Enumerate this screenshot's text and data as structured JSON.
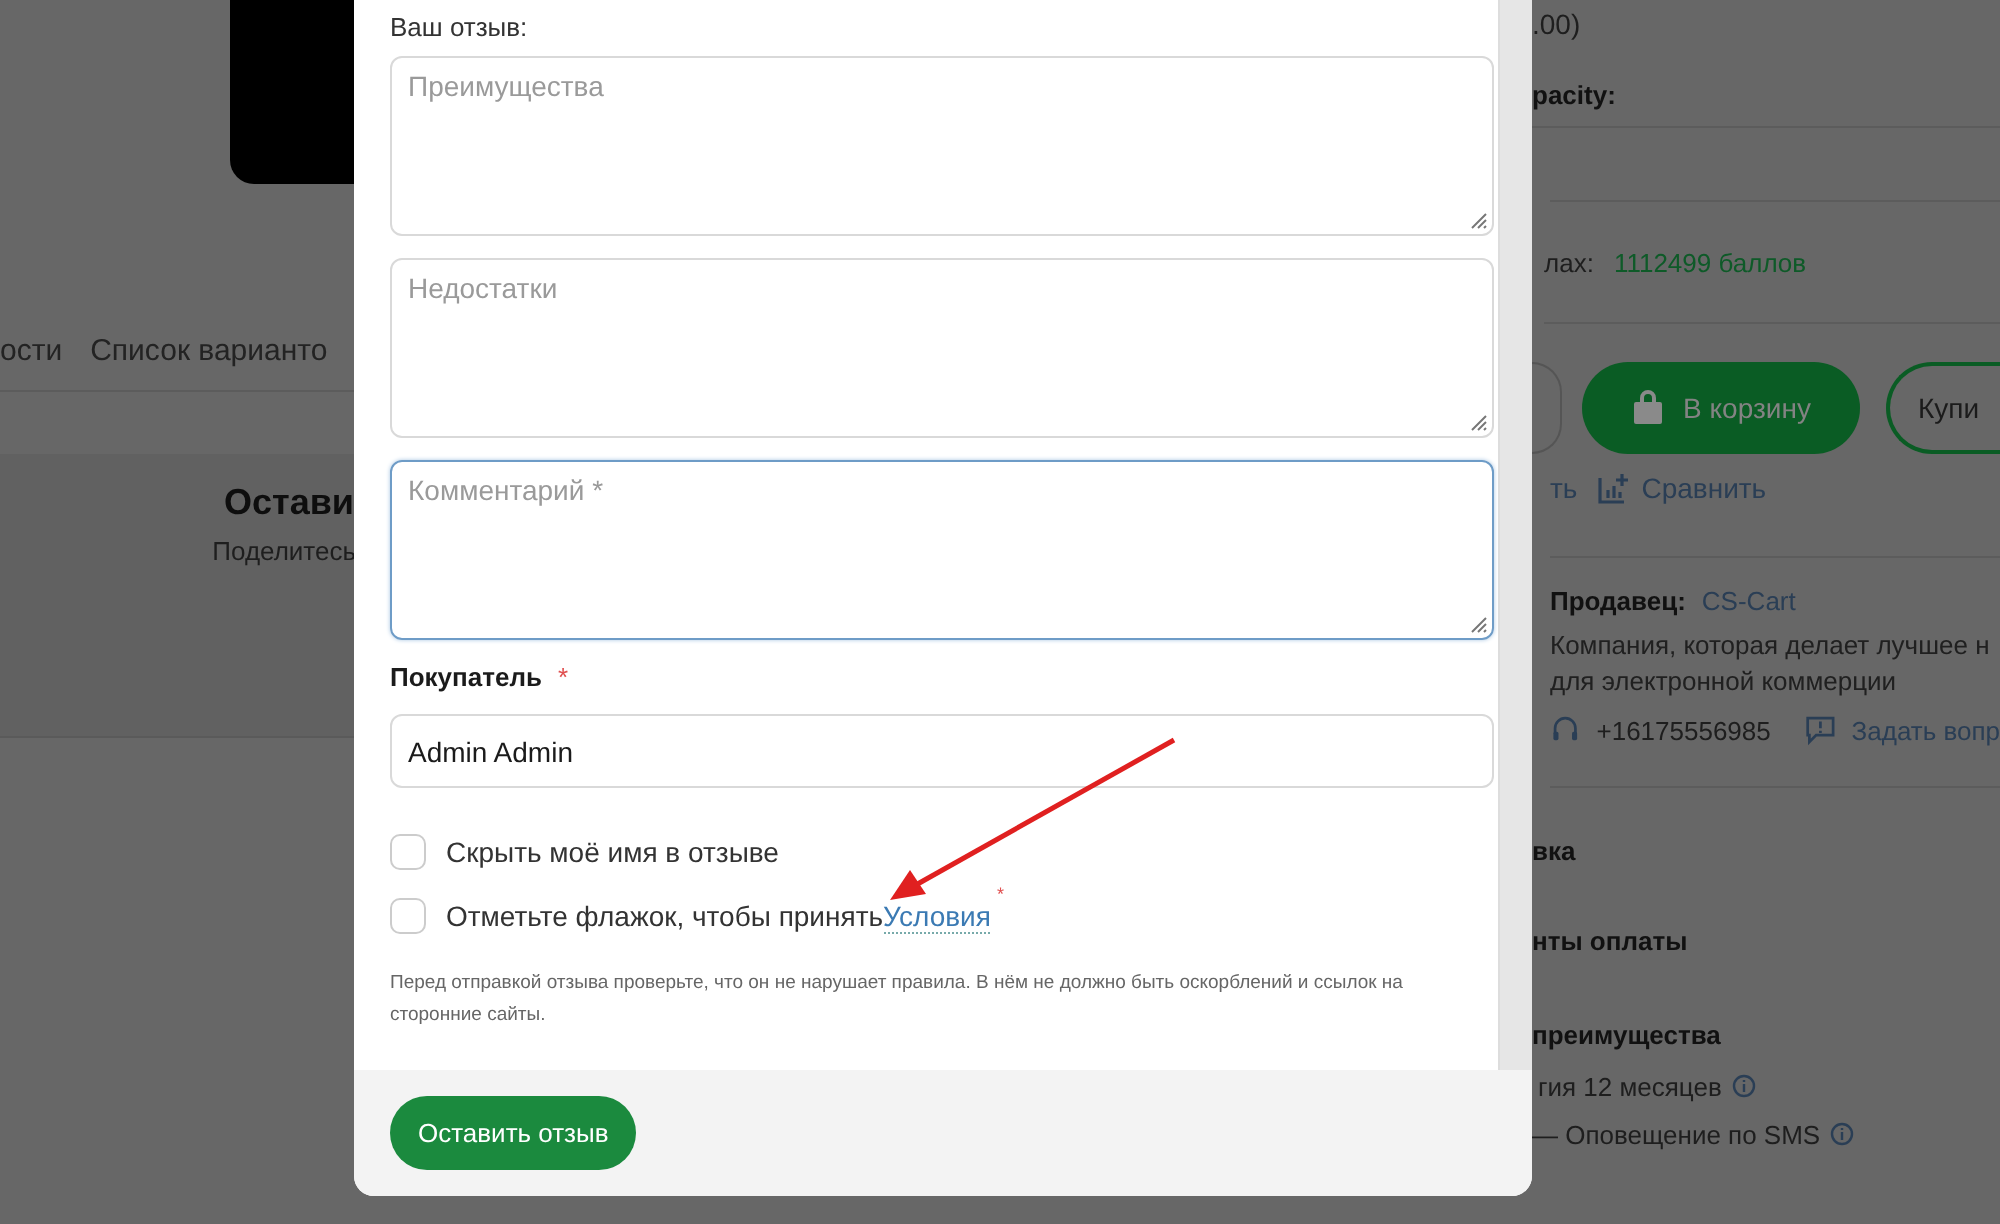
{
  "left_column": {
    "tabs": [
      {
        "label": "ости",
        "selected": false
      },
      {
        "label": "Список варианто",
        "selected": false
      }
    ],
    "review_heading": "Остави",
    "review_subtitle": "Поделитесь"
  },
  "review_modal": {
    "section_label": "Ваш отзыв:",
    "textareas": [
      {
        "placeholder": "Преимущества",
        "focused": false
      },
      {
        "placeholder": "Недостатки",
        "focused": false
      },
      {
        "placeholder": "Комментарий *",
        "focused": true
      }
    ],
    "customer_label": "Покупатель",
    "customer_required_mark": "*",
    "customer_value": "Admin Admin",
    "checkboxes": [
      {
        "label": "Скрыть моё имя в отзыве",
        "checked": false
      },
      {
        "label": "Отметьте флажок, чтобы принять",
        "link": "Условия",
        "required_mark": "*",
        "checked": false
      }
    ],
    "notice": "Перед отправкой отзыва проверьте, что он не нарушает правила. В нём не должно быть оскорблений и ссылок на сторонние сайты.",
    "submit_button": "Оставить отзыв"
  },
  "right_column": {
    "price_note": ".00)",
    "option_label": "pacity:",
    "points_label": "лах:",
    "points_value": "1112499 баллов",
    "cart_button": "В корзину",
    "buy_button": "Купи",
    "wishlist_link": "ть",
    "compare_link": "Сравнить",
    "seller_label": "Продавец:",
    "seller_name": "CS-Cart",
    "seller_description": "Компания, которая делает лучшее н для электронной коммерции",
    "phone": "+16175556985",
    "ask_link": "Задать вопр",
    "sections": [
      "вка",
      "нты оплаты",
      "преимущества"
    ],
    "features": [
      "гия 12 месяцев",
      "— Оповещение по SMS"
    ]
  }
}
